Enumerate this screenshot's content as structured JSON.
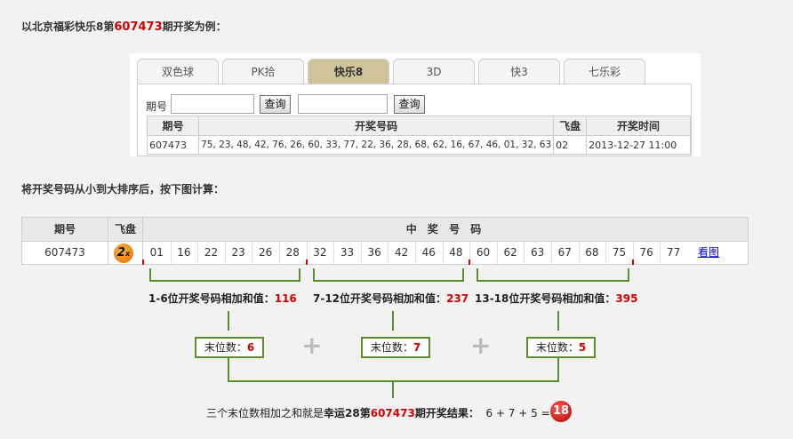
{
  "intro": {
    "prefix": "以北京福彩快乐8第",
    "issue": "607473",
    "suffix": "期开奖为例："
  },
  "tabs": [
    "双色球",
    "PK拾",
    "快乐8",
    "3D",
    "快3",
    "七乐彩"
  ],
  "active_tab": "快乐8",
  "query": {
    "label": "期号",
    "button": "查询",
    "button2": "查询",
    "input_value": "",
    "input2_value": ""
  },
  "result_table": {
    "headers": [
      "期号",
      "开奖号码",
      "飞盘",
      "开奖时间"
    ],
    "row": {
      "issue": "607473",
      "numbers": "75, 23, 48, 42, 76, 26, 60, 33, 77, 22, 36, 28, 68, 62, 16, 67, 46, 01, 32, 63",
      "fly": "02",
      "time": "2013-12-27 11:00"
    }
  },
  "step2": "将开奖号码从小到大排序后，按下图计算：",
  "draw_table": {
    "headers": {
      "issue": "期号",
      "fly": "飞盘",
      "numbers": "中 奖 号 码"
    },
    "issue": "607473",
    "fly_value": "2",
    "fly_suffix": "x",
    "numbers": [
      "01",
      "16",
      "22",
      "23",
      "26",
      "28",
      "32",
      "33",
      "36",
      "42",
      "46",
      "48",
      "60",
      "62",
      "63",
      "67",
      "68",
      "75",
      "76",
      "77"
    ],
    "link": "看图"
  },
  "sums": [
    {
      "label": "1-6位开奖号码相加",
      "bold": "和值",
      "colon": "：",
      "value": "116"
    },
    {
      "label": "7-12位开奖号码相加",
      "bold": "和值",
      "colon": "：",
      "value": "237"
    },
    {
      "label": "13-18位开奖号码相加",
      "bold": "和值",
      "colon": "：",
      "value": "395"
    }
  ],
  "tails": [
    {
      "label": "末位数：",
      "value": "6"
    },
    {
      "label": "末位数：",
      "value": "7"
    },
    {
      "label": "末位数：",
      "value": "5"
    }
  ],
  "plus": "+",
  "final": {
    "prefix": "三个末位数相加之和就是",
    "bold": "幸运28第",
    "issue": "607473",
    "suffix": "期开奖结果：",
    "formula": "6 + 7 + 5 =",
    "result": "18"
  },
  "colors": {
    "accent_red": "#d40000",
    "bracket_green": "#5a8f2a",
    "active_tab": "#cfc39b"
  }
}
